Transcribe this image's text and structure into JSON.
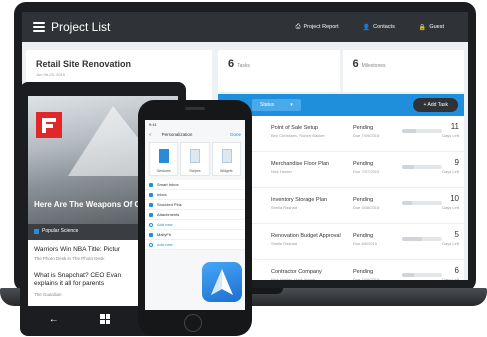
{
  "app": {
    "title": "Project List",
    "nav": [
      {
        "label": "Project Report",
        "icon": "printer-icon",
        "glyph": "⎙"
      },
      {
        "label": "Contacts",
        "icon": "person-icon",
        "glyph": "👤"
      },
      {
        "label": "Guest",
        "icon": "lock-icon",
        "glyph": "🔒"
      }
    ]
  },
  "project": {
    "name": "Retail Site Renovation",
    "date": "Jun 06-25, 2015"
  },
  "stats": [
    {
      "value": "6",
      "label": "Tasks"
    },
    {
      "value": "6",
      "label": "Milestones"
    }
  ],
  "toolbar": {
    "status_label": "Status",
    "add_task_label": "+ Add Task"
  },
  "tasks": [
    {
      "name": "Point of Sale Setup",
      "people": "Ben Christians, Robert Backer",
      "status": "Pending",
      "due": "Due 7/09/2015",
      "days": "11",
      "days_label": "Days Left",
      "progress": 0.35
    },
    {
      "name": "Merchandise Floor Plan",
      "people": "Nick Hunter",
      "status": "Pending",
      "due": "Due 7/07/2015",
      "days": "9",
      "days_label": "Days Left",
      "progress": 0.3
    },
    {
      "name": "Inventory Storage Plan",
      "people": "Sheila Rashad",
      "status": "Pending",
      "due": "Due 5/08/2015",
      "days": "10",
      "days_label": "Days Left",
      "progress": 0.25
    },
    {
      "name": "Renovation Budget Approval",
      "people": "Sheila Rashad",
      "status": "Pending",
      "due": "Due 6/6/2015",
      "days": "5",
      "days_label": "Days Left",
      "progress": 0.5
    },
    {
      "name": "Contractor Company",
      "people": "Nick Hunter, Mark Yonah",
      "status": "Pending",
      "due": "Due 7/08/2015",
      "days": "6",
      "days_label": "Days Left",
      "progress": 0.3
    }
  ],
  "windows_phone": {
    "headline": "Here Are The Weapons Of Cold War",
    "source": "Popular Science",
    "items": [
      {
        "title": "Warriors Win NBA Title: Pictur",
        "sub": "The Photo Desk in The Photo Desk"
      },
      {
        "title": "What is Snapchat? CEO Evan explains it all for parents",
        "sub": "The Guardian"
      }
    ]
  },
  "iphone": {
    "status_time": "9:41",
    "nav_back": "<",
    "nav_title": "Personalization",
    "nav_done": "Done",
    "cards": [
      "Gestures",
      "Swipes",
      "Widgets"
    ],
    "menu": [
      {
        "label": "Smart Inbox",
        "add": false
      },
      {
        "label": "Inbox",
        "add": false
      },
      {
        "label": "Snoozed Pins",
        "add": false
      },
      {
        "label": "Attachments",
        "add": false
      },
      {
        "label": "Add new",
        "add": true
      },
      {
        "label": "MailyFit",
        "add": false
      },
      {
        "label": "Add new",
        "add": true
      }
    ]
  },
  "colors": {
    "accent": "#1f8fdc",
    "header": "#2f3337",
    "flipboard": "#e12828"
  }
}
